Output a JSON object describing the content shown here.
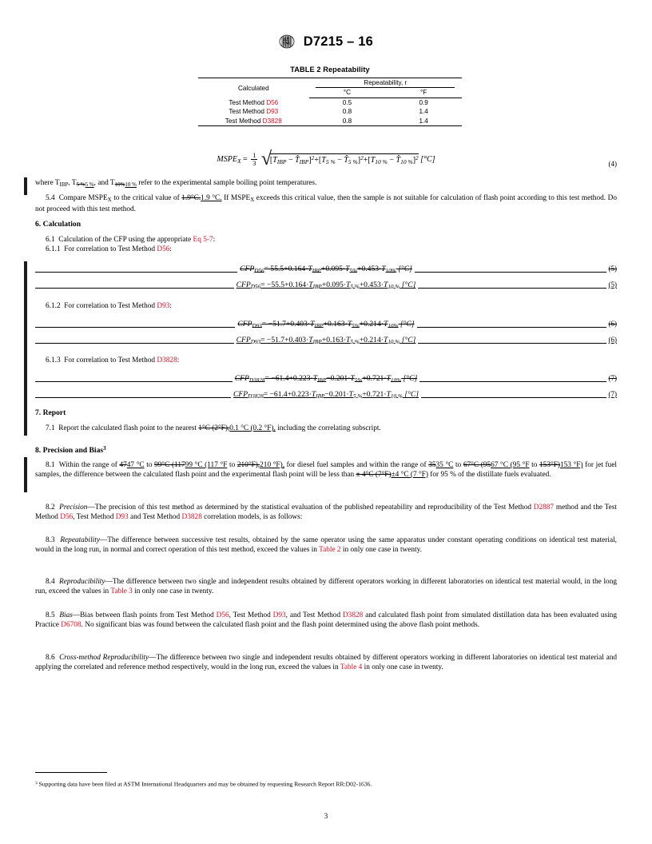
{
  "header": {
    "logo_alt": "ASTM logo",
    "doc_id": "D7215 – 16"
  },
  "table2": {
    "title": "TABLE 2 Repeatability",
    "col_calculated": "Calculated",
    "col_group": "Repeatability, r",
    "col_c": "°C",
    "col_f": "°F",
    "rows": [
      {
        "method_prefix": "Test Method ",
        "method": "D56",
        "c": "0.5",
        "f": "0.9"
      },
      {
        "method_prefix": "Test Method ",
        "method": "D93",
        "c": "0.8",
        "f": "1.4"
      },
      {
        "method_prefix": "Test Method ",
        "method": "D3828",
        "c": "0.8",
        "f": "1.4"
      }
    ]
  },
  "eq4": {
    "lhs": "MSPE",
    "lhs_sub": "X",
    "eq": "=",
    "frac_n": "1",
    "frac_d": "3",
    "t1": "T",
    "t1_sub": "IBP",
    "t1h": "T̂",
    "t1h_sub": "IBP",
    "t2": "T",
    "t2_sub": "5 %",
    "t2h": "T̂",
    "t2h_sub": "5 %",
    "t3": "T",
    "t3_sub": "10 %",
    "t3h": "T̂",
    "t3h_sub": "10 %",
    "unit": "[°C]",
    "number": "(4)"
  },
  "where_line": {
    "prefix": "where T",
    "sub1": "IBP",
    "mid1": ", T",
    "sub2_del": "5 %",
    "sub2_ins": "5 %",
    "mid2": ", and T",
    "sub3_del": "10%",
    "sub3_ins": "10 %",
    "suffix": " refer to the experimental sample boiling point temperatures."
  },
  "p54": {
    "num": "5.4",
    "part1": "Compare MSPE",
    "sub": "X",
    "part2": " to the critical value of ",
    "del": "1.9°C.",
    "ins": "1.9 °C.",
    "part3": " If MSPE",
    "sub2": "X",
    "part4": " exceeds this critical value, then the sample is not suitable for calculation of flash point according to this test method. Do not proceed with this test method."
  },
  "sec6": {
    "heading": "6.  Calculation",
    "p61_num": "6.1",
    "p61_a": "Calculation of the CFP using the appropriate ",
    "p61_link": "Eq 5-7",
    "p61_b": ":",
    "p611_num": "6.1.1",
    "p611_a": "For correlation to Test Method ",
    "p611_link": "D56",
    "p611_b": ":",
    "p612_num": "6.1.2",
    "p612_a": "For correlation to Test Method ",
    "p612_link": "D93",
    "p612_b": ":",
    "p613_num": "6.1.3",
    "p613_a": "For correlation to Test Method ",
    "p613_link": "D3828",
    "p613_b": ":"
  },
  "equations": [
    {
      "id": "eq5-del",
      "state": "deleted",
      "text": "CFPₘ₀₅₆ = 55.5+0.164·T₁ᵢ₀ +0.095·T₅% +0.453·T₁₀% [°C]",
      "lhs": "CFP",
      "lhs_sub": "D56",
      "rhs": "= 55.5+0.164·",
      "number": "(5)"
    },
    {
      "id": "eq5-ins",
      "state": "inserted",
      "lhs": "CFP",
      "lhs_sub": "D56",
      "rhs": "= −55.5+0.164·",
      "number": "(5)"
    },
    {
      "id": "eq6-del",
      "state": "deleted",
      "lhs": "CFP",
      "lhs_sub": "D93",
      "rhs": "= −51.7+0.403·",
      "number": "(6)"
    },
    {
      "id": "eq6-ins",
      "state": "inserted",
      "lhs": "CFP",
      "lhs_sub": "D93",
      "rhs": "= −51.7+0.403·",
      "number": "(6)"
    },
    {
      "id": "eq7-del",
      "state": "deleted",
      "lhs": "CFP",
      "lhs_sub": "D3828",
      "rhs": "= −61.4+0.223·",
      "number": "(7)"
    },
    {
      "id": "eq7-ins",
      "state": "inserted",
      "lhs": "CFP",
      "lhs_sub": "D3828",
      "rhs": "= −61.4+0.223·",
      "number": "(7)"
    }
  ],
  "eq5_terms": {
    "c0": "−55.5",
    "c0_del": "55.5",
    "a1": "+0.164·",
    "t1": "T",
    "t1s": "IBP",
    "a2": "+0.095·",
    "t2": "T",
    "t2s": "5 %",
    "t2s_del": "5%",
    "a3": "+0.453·",
    "t3": "T",
    "t3s": "10 %",
    "t3s_del": "10%",
    "unit": "[°C]"
  },
  "eq6_terms": {
    "c0": "−51.7",
    "a1": "+0.403·",
    "t1": "T",
    "t1s": "IBP",
    "a2": "+0.163·",
    "t2": "T",
    "t2s": "5 %",
    "t2s_del": "5%",
    "a3": "+0.214·",
    "t3": "T",
    "t3s": "10 %",
    "t3s_del": "10%",
    "unit": "[°C]"
  },
  "eq7_terms": {
    "c0": "−61.4",
    "a1": "+0.223·",
    "t1": "T",
    "t1s": "IBP",
    "a2": "−0.201·",
    "t2": "T",
    "t2s": "5 %",
    "t2s_del": "5%",
    "a3": "+0.721·",
    "t3": "T",
    "t3s": "10 %",
    "t3s_del": "10%",
    "unit": "[°C]"
  },
  "sec7": {
    "heading": "7.  Report",
    "p71_num": "7.1",
    "p71_a": "Report the calculated flash point to the nearest ",
    "p71_del": "1°C (2°F),",
    "p71_ins": "0.1 °C (0.2 °F),",
    "p71_b": " including the correlating subscript."
  },
  "sec8": {
    "heading_a": "8.  Precision and Bias",
    "heading_sup": "3",
    "p81_num": "8.1",
    "p81_a": "Within the range of ",
    "p81_del1": "47",
    "p81_ins1": "47 °C",
    "p81_b": " to ",
    "p81_del2": "99°C (117",
    "p81_ins2": "99 °C (117 °F",
    "p81_c": " to ",
    "p81_del3": "210°F),",
    "p81_ins3": "210 °F),",
    "p81_d": " for diesel fuel samples and within the range of ",
    "p81_del4": "35",
    "p81_ins4": "35 °C",
    "p81_e": " to ",
    "p81_del5": "67°C (95",
    "p81_ins5": "67 °C (95 °F",
    "p81_f": " to ",
    "p81_del6": "153°F)",
    "p81_ins6": "153 °F)",
    "p81_g": " for jet fuel samples, the difference between the calculated flash point and the experimental flash point will be less than ",
    "p81_del7": "± 4°C (7°F)",
    "p81_ins7": "±4 °C (7 °F)",
    "p81_h": " for 95 % of the distillate fuels evaluated.",
    "p82_num": "8.2",
    "p82_title": "Precision",
    "p82_a": "—The precision of this test method as determined by the statistical evaluation of the published repeatability and reproducibility of the Test Method ",
    "p82_l1": "D2887",
    "p82_b": " method and the Test Method ",
    "p82_l2": "D56",
    "p82_c": ", Test Method ",
    "p82_l3": "D93",
    "p82_d": " and Test Method ",
    "p82_l4": "D3828",
    "p82_e": " correlation models, is as follows:",
    "p83_num": "8.3",
    "p83_title": "Repeatability",
    "p83_a": "—The difference between successive test results, obtained by the same operator using the same apparatus under constant operating conditions on identical test material, would in the long run, in normal and correct operation of this test method, exceed the values in ",
    "p83_l1": "Table 2",
    "p83_b": " in only one case in twenty.",
    "p84_num": "8.4",
    "p84_title": "Reproducibility",
    "p84_a": "—The difference between two single and independent results obtained by different operators working in different laboratories on identical test material would, in the long run, exceed the values in ",
    "p84_l1": "Table 3",
    "p84_b": " in only one case in twenty.",
    "p85_num": "8.5",
    "p85_title": "Bias",
    "p85_a": "—Bias between flash points from Test Method ",
    "p85_l1": "D56",
    "p85_b": ", Test Method ",
    "p85_l2": "D93",
    "p85_c": ", and Test Method ",
    "p85_l3": "D3828",
    "p85_d": " and calculated flash point from simulated distillation data has been evaluated using Practice ",
    "p85_l4": "D6708",
    "p85_e": ". No significant bias was found between the calculated flash point and the flash point determined using the above flash point methods.",
    "p86_num": "8.6",
    "p86_title": "Cross-method Reproducibility",
    "p86_a": "—The difference between two single and independent results obtained by different operators working in different laboratories on identical test material and applying the correlated and reference method respectively, would in the long run, exceed the values in ",
    "p86_l1": "Table 4",
    "p86_b": " in only one case in twenty."
  },
  "footnote": {
    "marker": "3",
    "text": " Supporting data have been filed at ASTM International Headquarters and may be obtained by requesting Research Report RR:D02-1636."
  },
  "page_number": "3",
  "colors": {
    "link_red": "#cf1126",
    "text": "#000000",
    "change_bar": "#1b1b1b"
  }
}
